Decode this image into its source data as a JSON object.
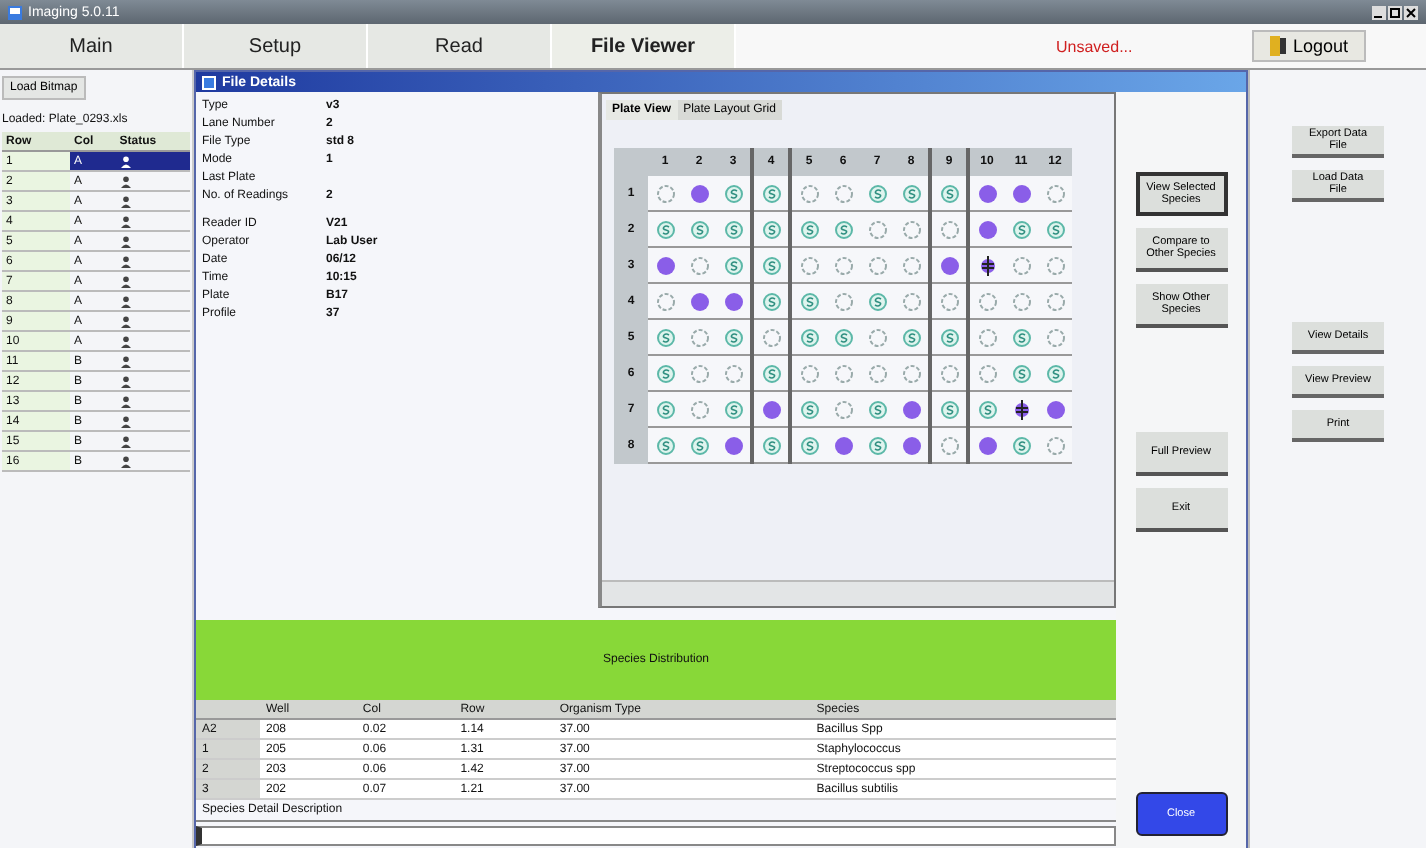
{
  "window": {
    "title": "Imaging 5.0.11"
  },
  "menu": [
    {
      "label": "Main",
      "selected": false
    },
    {
      "label": "Setup",
      "selected": false
    },
    {
      "label": "Read",
      "selected": false
    },
    {
      "label": "File Viewer",
      "selected": true
    }
  ],
  "status_text": "Unsaved...",
  "logout_button": "Logout",
  "left_panel": {
    "load_button": "Load Bitmap",
    "loaded_text": "Loaded: Plate_0293.xls",
    "columns": [
      "Row",
      "Col",
      "Status"
    ],
    "rows": [
      {
        "cells": [
          "1",
          "A"
        ],
        "selected": true
      },
      {
        "cells": [
          "2",
          "A"
        ],
        "selected": false
      },
      {
        "cells": [
          "3",
          "A"
        ],
        "selected": false
      },
      {
        "cells": [
          "4",
          "A"
        ],
        "selected": false
      },
      {
        "cells": [
          "5",
          "A"
        ],
        "selected": false
      },
      {
        "cells": [
          "6",
          "A"
        ],
        "selected": false
      },
      {
        "cells": [
          "7",
          "A"
        ],
        "selected": false
      },
      {
        "cells": [
          "8",
          "A"
        ],
        "selected": false
      },
      {
        "cells": [
          "9",
          "A"
        ],
        "selected": false
      },
      {
        "cells": [
          "10",
          "A"
        ],
        "selected": false
      },
      {
        "cells": [
          "11",
          "B"
        ],
        "selected": false
      },
      {
        "cells": [
          "12",
          "B"
        ],
        "selected": false
      },
      {
        "cells": [
          "13",
          "B"
        ],
        "selected": false
      },
      {
        "cells": [
          "14",
          "B"
        ],
        "selected": false
      },
      {
        "cells": [
          "15",
          "B"
        ],
        "selected": false
      },
      {
        "cells": [
          "16",
          "B"
        ],
        "selected": false
      }
    ]
  },
  "dialog": {
    "title": "File Details",
    "info_groups": [
      [
        {
          "label": "Type",
          "value": "v3"
        },
        {
          "label": "Lane Number",
          "value": "2"
        },
        {
          "label": "File Type",
          "value": "std 8"
        },
        {
          "label": "Mode",
          "value": "1"
        },
        {
          "label": "Last Plate"
        },
        {
          "label": "No. of Readings",
          "value": "2"
        }
      ],
      [
        {
          "label": "Reader ID",
          "value": "V21"
        },
        {
          "label": "Operator",
          "value": "Lab User"
        },
        {
          "label": "Date",
          "value": "06/12"
        },
        {
          "label": "Time",
          "value": "10:15"
        },
        {
          "label": "Plate",
          "value": "B17"
        },
        {
          "label": "Profile",
          "value": "37"
        }
      ]
    ],
    "tabs": [
      {
        "label": "Plate View",
        "selected": true
      },
      {
        "label": "Plate Layout Grid",
        "selected": false
      }
    ],
    "plate": {
      "columns": [
        "1",
        "2",
        "3",
        "4",
        "5",
        "6",
        "7",
        "8",
        "9",
        "10",
        "11",
        "12"
      ],
      "rows": [
        {
          "label": "1",
          "wells": [
            {
              "kind": "empty"
            },
            {
              "kind": "filled"
            },
            {
              "kind": "swirl"
            },
            {
              "kind": "swirl"
            },
            {
              "kind": "empty"
            },
            {
              "kind": "empty"
            },
            {
              "kind": "swirl"
            },
            {
              "kind": "swirl"
            },
            {
              "kind": "swirl"
            },
            {
              "kind": "filled"
            },
            {
              "kind": "filled"
            },
            {
              "kind": "empty"
            }
          ]
        },
        {
          "label": "2",
          "wells": [
            {
              "kind": "swirl"
            },
            {
              "kind": "swirl"
            },
            {
              "kind": "swirl"
            },
            {
              "kind": "swirl"
            },
            {
              "kind": "swirl"
            },
            {
              "kind": "swirl"
            },
            {
              "kind": "empty"
            },
            {
              "kind": "empty"
            },
            {
              "kind": "empty"
            },
            {
              "kind": "filled"
            },
            {
              "kind": "swirl"
            },
            {
              "kind": "swirl"
            }
          ]
        },
        {
          "label": "3",
          "wells": [
            {
              "kind": "filled"
            },
            {
              "kind": "empty"
            },
            {
              "kind": "swirl"
            },
            {
              "kind": "swirl"
            },
            {
              "kind": "empty"
            },
            {
              "kind": "empty"
            },
            {
              "kind": "empty"
            },
            {
              "kind": "empty"
            },
            {
              "kind": "filled"
            },
            {
              "kind": "marked"
            },
            {
              "kind": "empty"
            },
            {
              "kind": "empty"
            }
          ]
        },
        {
          "label": "4",
          "wells": [
            {
              "kind": "empty"
            },
            {
              "kind": "filled"
            },
            {
              "kind": "filled"
            },
            {
              "kind": "swirl"
            },
            {
              "kind": "swirl"
            },
            {
              "kind": "empty"
            },
            {
              "kind": "swirl"
            },
            {
              "kind": "empty"
            },
            {
              "kind": "empty"
            },
            {
              "kind": "empty"
            },
            {
              "kind": "empty"
            },
            {
              "kind": "empty"
            }
          ]
        },
        {
          "label": "5",
          "wells": [
            {
              "kind": "swirl"
            },
            {
              "kind": "empty"
            },
            {
              "kind": "swirl"
            },
            {
              "kind": "empty"
            },
            {
              "kind": "swirl"
            },
            {
              "kind": "swirl"
            },
            {
              "kind": "empty"
            },
            {
              "kind": "swirl"
            },
            {
              "kind": "swirl"
            },
            {
              "kind": "empty"
            },
            {
              "kind": "swirl"
            },
            {
              "kind": "empty"
            }
          ]
        },
        {
          "label": "6",
          "wells": [
            {
              "kind": "swirl"
            },
            {
              "kind": "empty"
            },
            {
              "kind": "empty"
            },
            {
              "kind": "swirl"
            },
            {
              "kind": "empty"
            },
            {
              "kind": "empty"
            },
            {
              "kind": "empty"
            },
            {
              "kind": "empty"
            },
            {
              "kind": "empty"
            },
            {
              "kind": "empty"
            },
            {
              "kind": "swirl"
            },
            {
              "kind": "swirl"
            }
          ]
        },
        {
          "label": "7",
          "wells": [
            {
              "kind": "swirl"
            },
            {
              "kind": "empty"
            },
            {
              "kind": "swirl"
            },
            {
              "kind": "filled"
            },
            {
              "kind": "swirl"
            },
            {
              "kind": "empty"
            },
            {
              "kind": "swirl"
            },
            {
              "kind": "filled"
            },
            {
              "kind": "swirl"
            },
            {
              "kind": "swirl"
            },
            {
              "kind": "marked"
            },
            {
              "kind": "filled"
            }
          ]
        },
        {
          "label": "8",
          "wells": [
            {
              "kind": "swirl"
            },
            {
              "kind": "swirl"
            },
            {
              "kind": "filled"
            },
            {
              "kind": "swirl"
            },
            {
              "kind": "swirl"
            },
            {
              "kind": "filled"
            },
            {
              "kind": "swirl"
            },
            {
              "kind": "filled"
            },
            {
              "kind": "empty"
            },
            {
              "kind": "filled"
            },
            {
              "kind": "swirl"
            },
            {
              "kind": "empty"
            }
          ]
        }
      ]
    },
    "banner": "Species Distribution",
    "table": {
      "columns": [
        "Well",
        "Col",
        "Row",
        "Organism Type",
        "Species"
      ],
      "rows": [
        {
          "header": "A2",
          "cells": [
            "208",
            "0.02",
            "1.14",
            "37.00",
            "Bacillus Spp"
          ]
        },
        {
          "header": "1",
          "cells": [
            "205",
            "0.06",
            "1.31",
            "37.00",
            "Staphylococcus"
          ]
        },
        {
          "header": "2",
          "cells": [
            "203",
            "0.06",
            "1.42",
            "37.00",
            "Streptococcus spp"
          ]
        },
        {
          "header": "3",
          "cells": [
            "202",
            "0.07",
            "1.21",
            "37.00",
            "Bacillus subtilis"
          ]
        }
      ]
    },
    "description_label": "Species Detail Description",
    "buttons": [
      {
        "label": "View Selected Species",
        "kind": "default"
      },
      {
        "label": "Compare to Other Species",
        "kind": "normal"
      },
      {
        "label": "Show Other Species",
        "kind": "normal"
      },
      {
        "label": "Full Preview",
        "kind": "normal"
      },
      {
        "label": "Exit",
        "kind": "normal"
      },
      {
        "label": "Close",
        "kind": "primary"
      }
    ]
  },
  "side_buttons": [
    "Export Data File",
    "Load Data File",
    "View Details",
    "View Preview",
    "Print"
  ]
}
